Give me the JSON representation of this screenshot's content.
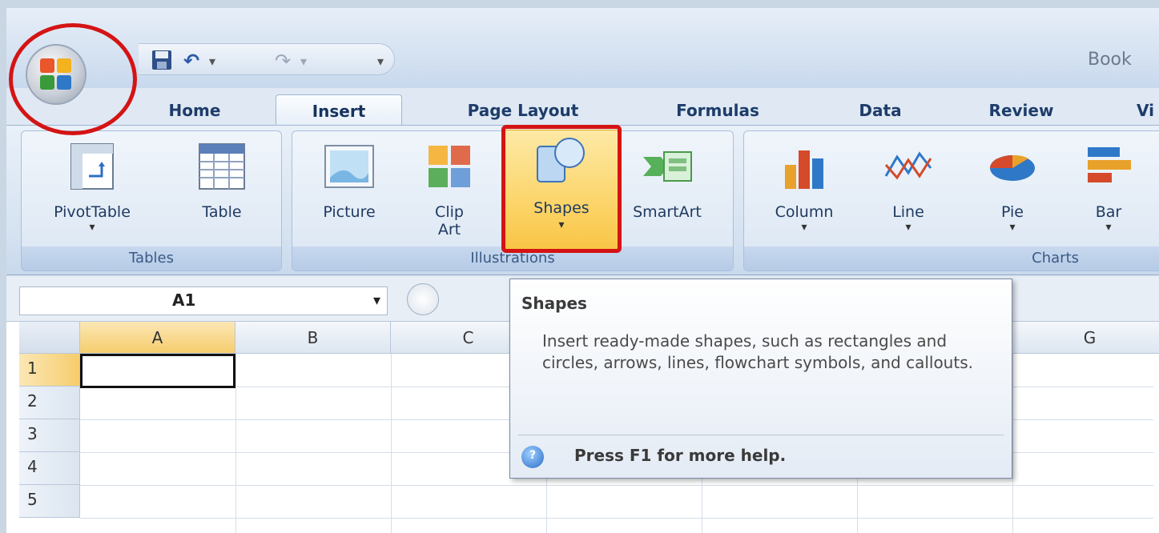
{
  "title_text": "Book",
  "tabs": [
    {
      "label": "Home"
    },
    {
      "label": "Insert"
    },
    {
      "label": "Page Layout"
    },
    {
      "label": "Formulas"
    },
    {
      "label": "Data"
    },
    {
      "label": "Review"
    },
    {
      "label": "Vi"
    }
  ],
  "ribbon": {
    "tables": {
      "label": "Tables",
      "pivottable": "PivotTable",
      "table": "Table"
    },
    "illustrations": {
      "label": "Illustrations",
      "picture": "Picture",
      "clip_art_1": "Clip",
      "clip_art_2": "Art",
      "shapes": "Shapes",
      "smartart": "SmartArt"
    },
    "charts": {
      "label": "Charts",
      "column": "Column",
      "line": "Line",
      "pie": "Pie",
      "bar": "Bar"
    },
    "dropdown_glyph": "▾"
  },
  "formula_bar": {
    "name_box": "A1",
    "dropdown_glyph": "▾"
  },
  "grid": {
    "columns": [
      "A",
      "B",
      "C",
      "G"
    ],
    "rows": [
      "1",
      "2",
      "3",
      "4",
      "5"
    ]
  },
  "tooltip": {
    "title": "Shapes",
    "body": "Insert ready-made shapes, such as rectangles and circles, arrows, lines, flowchart symbols, and callouts.",
    "help": "Press F1 for more help."
  },
  "qat": {
    "undo": "↶",
    "redo": "↷",
    "more": "▾"
  }
}
